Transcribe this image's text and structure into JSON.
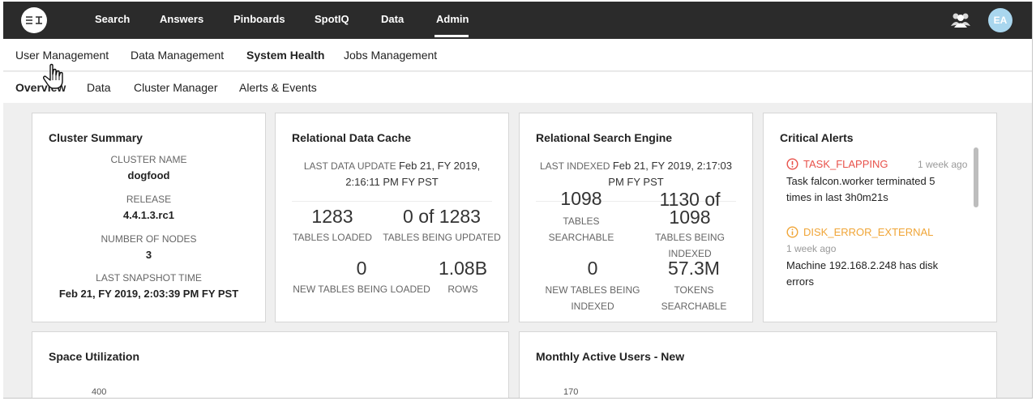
{
  "nav": {
    "items": [
      "Search",
      "Answers",
      "Pinboards",
      "SpotIQ",
      "Data",
      "Admin"
    ],
    "avatar_initials": "EA"
  },
  "subnav": {
    "items": [
      "User Management",
      "Data Management",
      "System Health",
      "Jobs Management"
    ]
  },
  "tabs": {
    "items": [
      "Overview",
      "Data",
      "Cluster Manager",
      "Alerts & Events"
    ]
  },
  "cluster_summary": {
    "title": "Cluster Summary",
    "cluster_name_label": "CLUSTER NAME",
    "cluster_name": "dogfood",
    "release_label": "RELEASE",
    "release": "4.4.1.3.rc1",
    "nodes_label": "NUMBER OF NODES",
    "nodes": "3",
    "snapshot_label": "LAST SNAPSHOT TIME",
    "snapshot": "Feb 21, FY 2019, 2:03:39 PM FY PST"
  },
  "data_cache": {
    "title": "Relational Data Cache",
    "last_update_label": "LAST DATA UPDATE",
    "last_update_line1": "Feb 21, FY 2019,",
    "last_update_line2": "2:16:11 PM FY PST",
    "tables_loaded": "1283",
    "tables_loaded_label": "TABLES LOADED",
    "tables_updated": "0 of 1283",
    "tables_updated_label": "TABLES BEING UPDATED",
    "new_tables": "0",
    "new_tables_label": "NEW TABLES BEING LOADED",
    "rows": "1.08B",
    "rows_label": "ROWS"
  },
  "search_engine": {
    "title": "Relational Search Engine",
    "last_indexed_label": "LAST INDEXED",
    "last_indexed_line1": "Feb 21, FY 2019, 2:17:03",
    "last_indexed_line2": "PM FY PST",
    "tables_searchable": "1098",
    "tables_searchable_label1": "TABLES",
    "tables_searchable_label2": "SEARCHABLE",
    "tables_indexed_line1": "1130 of",
    "tables_indexed_line2": "1098",
    "tables_indexed_label1": "TABLES BEING",
    "tables_indexed_label2": "INDEXED",
    "new_tables": "0",
    "new_tables_label1": "NEW TABLES BEING",
    "new_tables_label2": "INDEXED",
    "tokens": "57.3M",
    "tokens_label1": "TOKENS",
    "tokens_label2": "SEARCHABLE"
  },
  "critical_alerts": {
    "title": "Critical Alerts",
    "alerts": [
      {
        "name": "TASK_FLAPPING",
        "time": "1 week ago",
        "msg1": "Task falcon.worker terminated 5",
        "msg2": "times in last 3h0m21s",
        "color": "#e8514a"
      },
      {
        "name": "DISK_ERROR_EXTERNAL",
        "time": "1 week ago",
        "msg1": "Machine 192.168.2.248 has disk",
        "msg2": "errors",
        "color": "#f0a537"
      }
    ]
  },
  "space_utilization": {
    "title": "Space Utilization",
    "y_tick_top": "400"
  },
  "monthly_users": {
    "title": "Monthly Active Users - New",
    "y_tick_top": "170"
  }
}
